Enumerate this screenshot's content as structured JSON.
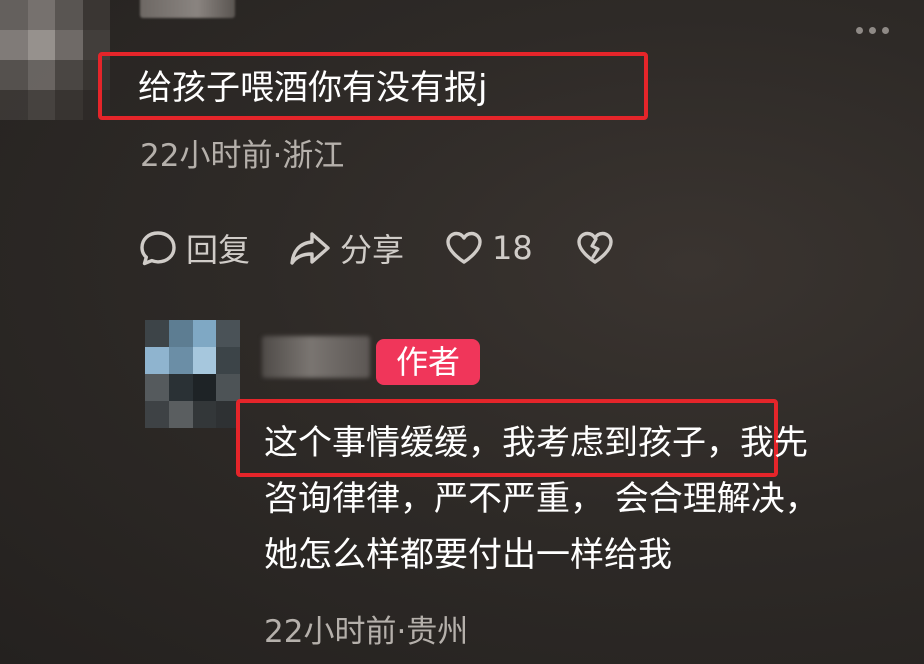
{
  "comment": {
    "text": "给孩子喂酒你有没有报j",
    "time": "22小时前",
    "location": "浙江",
    "meta": "22小时前·浙江"
  },
  "actions": {
    "reply_label": "回复",
    "share_label": "分享",
    "like_count": "18"
  },
  "reply": {
    "author_badge": "作者",
    "lines": [
      "这个事情缓缓，我考虑到孩子，我先",
      "咨询律律，严不严重， 会合理解决，",
      "她怎么样都要付出一样给我"
    ],
    "meta": "22小时前·贵州"
  },
  "colors": {
    "highlight": "#e5252a",
    "author_badge": "#f0365a",
    "meta_text": "#b5b0ab",
    "background": "#2e2a27"
  },
  "icons": {
    "reply": "comment-bubble-icon",
    "share": "share-arrow-icon",
    "like": "heart-icon",
    "dislike": "broken-heart-icon",
    "more": "more-dots-icon"
  }
}
